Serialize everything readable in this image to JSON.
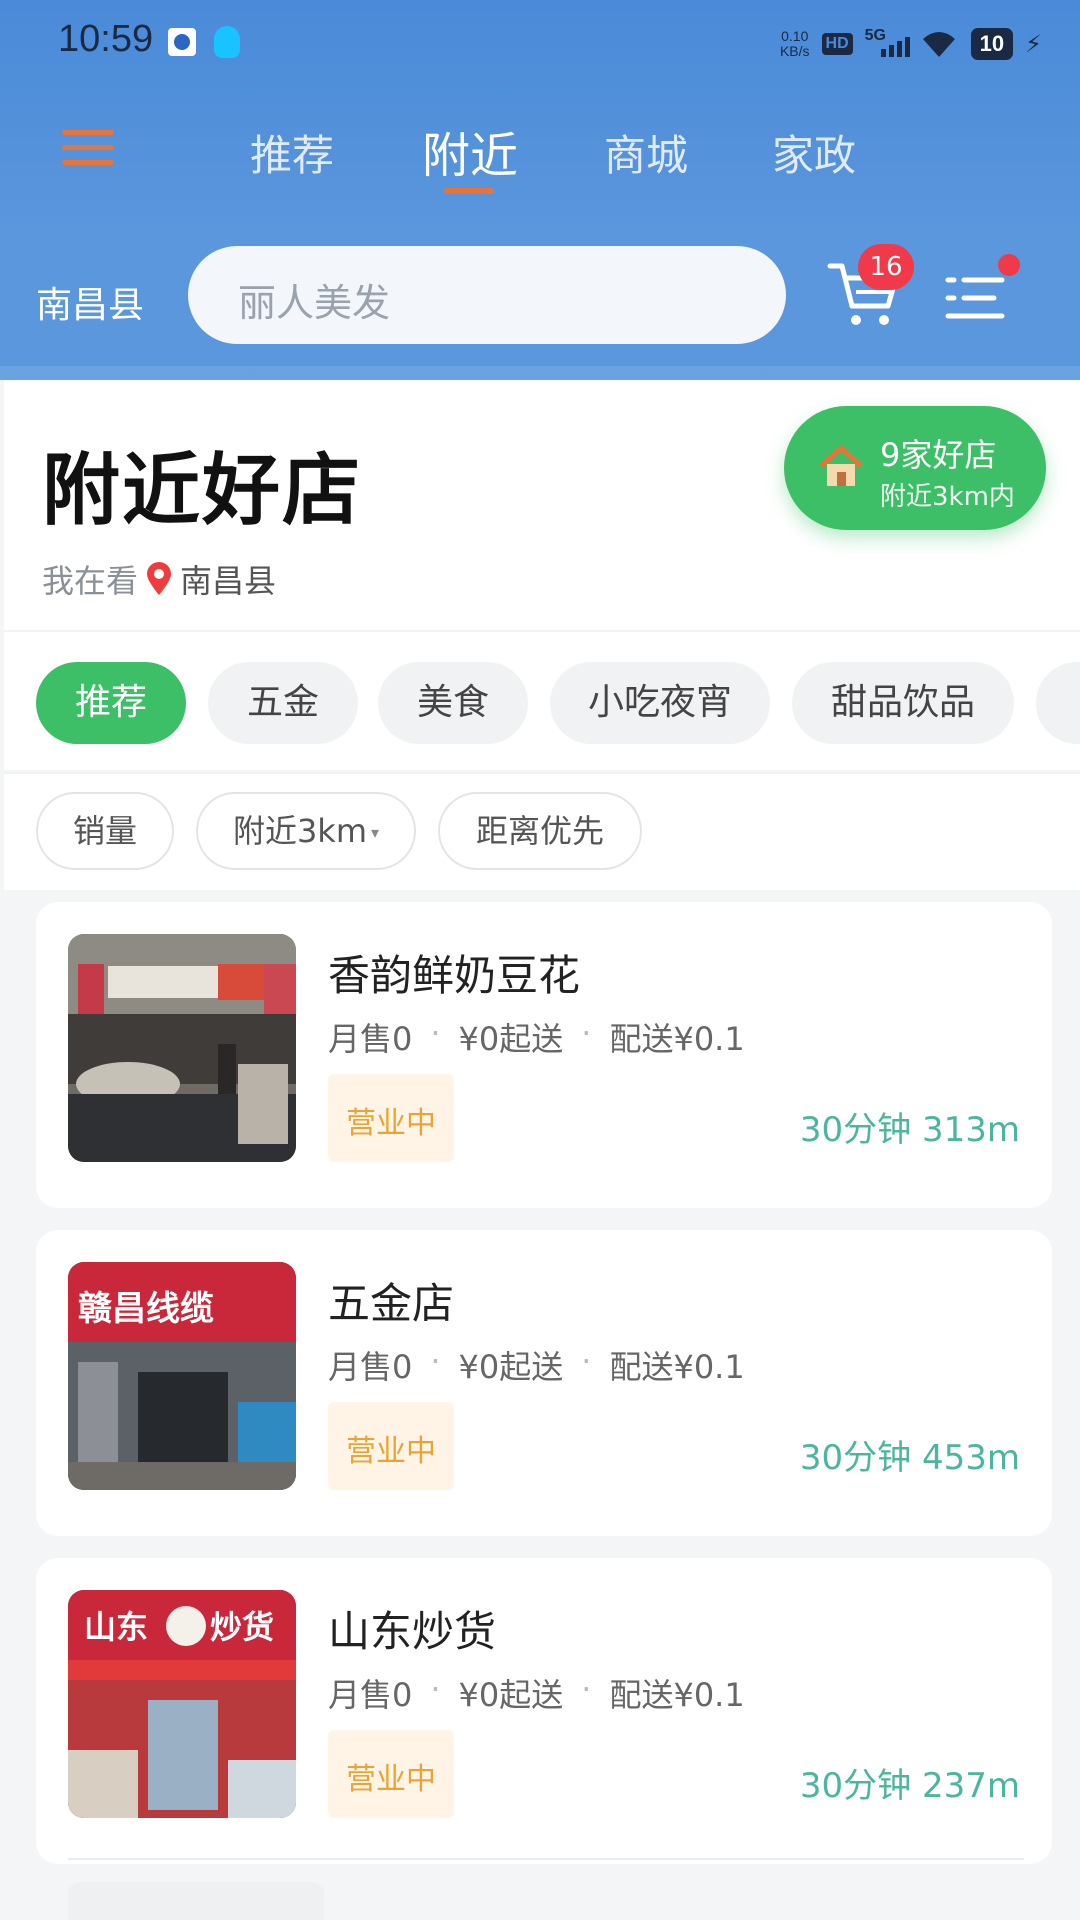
{
  "statusbar": {
    "time": "10:59",
    "net_speed_value": "0.10",
    "net_speed_unit": "KB/s",
    "hd": "HD",
    "signal": "5G",
    "battery": "10"
  },
  "nav": {
    "tabs": [
      {
        "label": "推荐"
      },
      {
        "label": "附近"
      },
      {
        "label": "商城"
      },
      {
        "label": "家政"
      }
    ],
    "active_tab": "附近"
  },
  "search": {
    "city": "南昌县",
    "placeholder": "丽人美发",
    "cart_count": "16"
  },
  "hero": {
    "title": "附近好店",
    "viewing_prefix": "我在看",
    "location": "南昌县",
    "shop_count": "9家好店",
    "range": "附近3km内"
  },
  "categories": [
    {
      "label": "推荐",
      "active": true
    },
    {
      "label": "五金",
      "active": false
    },
    {
      "label": "美食",
      "active": false
    },
    {
      "label": "小吃夜宵",
      "active": false
    },
    {
      "label": "甜品饮品",
      "active": false
    }
  ],
  "filters": [
    {
      "label": "销量"
    },
    {
      "label": "附近3km"
    },
    {
      "label": "距离优先"
    }
  ],
  "shops": [
    {
      "name": "香韵鲜奶豆花",
      "monthly_sales": "月售0",
      "min_order": "¥0起送",
      "delivery_fee": "配送¥0.1",
      "status": "营业中",
      "eta": "30分钟 313m"
    },
    {
      "name": "五金店",
      "monthly_sales": "月售0",
      "min_order": "¥0起送",
      "delivery_fee": "配送¥0.1",
      "status": "营业中",
      "eta": "30分钟 453m"
    },
    {
      "name": "山东炒货",
      "monthly_sales": "月售0",
      "min_order": "¥0起送",
      "delivery_fee": "配送¥0.1",
      "status": "营业中",
      "eta": "30分钟 237m"
    }
  ],
  "thumb_signs": {
    "shop2": "赣昌线缆",
    "shop3": "山东",
    "shop3_b": "炒货"
  },
  "icons": {
    "menu": "hamburger-icon",
    "cart": "cart-icon",
    "list": "list-icon",
    "pin": "location-pin-icon",
    "house": "house-icon"
  },
  "colors": {
    "header_blue": "#4a8ad8",
    "accent_orange": "#e8743a",
    "green": "#3cbf66",
    "badge_red": "#f03a4a",
    "eta_teal": "#4cb5a0",
    "open_orange": "#e8a434"
  }
}
